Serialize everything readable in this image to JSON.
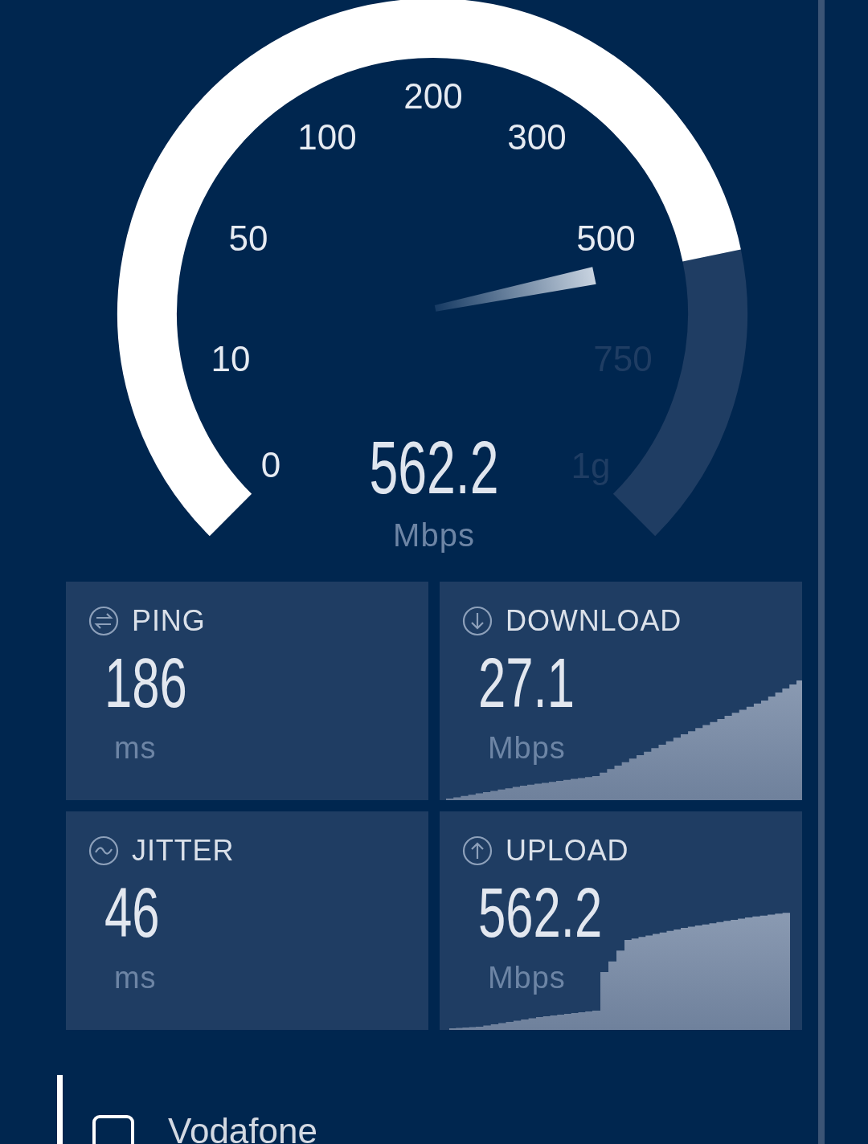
{
  "gauge": {
    "reading": "562.2",
    "unit": "Mbps",
    "ticks": [
      {
        "label": "0",
        "lit": true
      },
      {
        "label": "10",
        "lit": true
      },
      {
        "label": "50",
        "lit": true
      },
      {
        "label": "100",
        "lit": true
      },
      {
        "label": "200",
        "lit": true
      },
      {
        "label": "300",
        "lit": true
      },
      {
        "label": "500",
        "lit": true
      },
      {
        "label": "750",
        "lit": false
      },
      {
        "label": "1g",
        "lit": false
      }
    ]
  },
  "metrics": [
    {
      "kind": "ping",
      "label": "PING",
      "value": "186",
      "unit": "ms"
    },
    {
      "kind": "download",
      "label": "DOWNLOAD",
      "value": "27.1",
      "unit": "Mbps"
    },
    {
      "kind": "jitter",
      "label": "JITTER",
      "value": "46",
      "unit": "ms"
    },
    {
      "kind": "upload",
      "label": "UPLOAD",
      "value": "562.2",
      "unit": "Mbps"
    }
  ],
  "provider": {
    "name": "Vodafone"
  }
}
